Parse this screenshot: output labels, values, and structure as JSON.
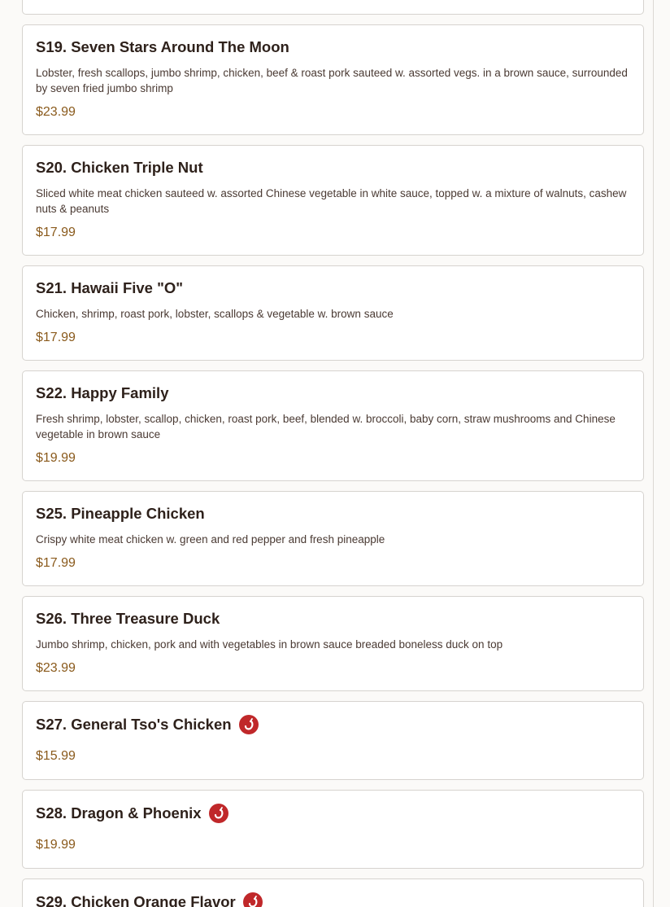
{
  "menu": {
    "items": [
      {
        "name": "S19. Seven Stars Around The Moon",
        "description": "Lobster, fresh scallops, jumbo shrimp, chicken, beef & roast pork sauteed w. assorted vegs. in a brown sauce, surrounded by seven fried jumbo shrimp",
        "price": "$23.99",
        "spicy": false
      },
      {
        "name": "S20. Chicken Triple Nut",
        "description": "Sliced white meat chicken sauteed w. assorted Chinese vegetable in white sauce, topped w. a mixture of walnuts, cashew nuts & peanuts",
        "price": "$17.99",
        "spicy": false
      },
      {
        "name": "S21. Hawaii Five \"O\"",
        "description": "Chicken, shrimp, roast pork, lobster, scallops & vegetable w. brown sauce",
        "price": "$17.99",
        "spicy": false
      },
      {
        "name": "S22. Happy Family",
        "description": "Fresh shrimp, lobster, scallop, chicken, roast pork, beef, blended w. broccoli, baby corn, straw mushrooms and Chinese vegetable in brown sauce",
        "price": "$19.99",
        "spicy": false
      },
      {
        "name": "S25. Pineapple Chicken",
        "description": "Crispy white meat chicken w. green and red pepper and fresh pineapple",
        "price": "$17.99",
        "spicy": false
      },
      {
        "name": "S26. Three Treasure Duck",
        "description": "Jumbo shrimp, chicken, pork and with vegetables in brown sauce breaded boneless duck on top",
        "price": "$23.99",
        "spicy": false
      },
      {
        "name": "S27. General Tso's Chicken",
        "description": "",
        "price": "$15.99",
        "spicy": true
      },
      {
        "name": "S28. Dragon & Phoenix",
        "description": "",
        "price": "$19.99",
        "spicy": true
      },
      {
        "name": "S29. Chicken Orange Flavor",
        "description": "",
        "price": "",
        "spicy": true
      }
    ]
  },
  "colors": {
    "price": "#8a5a1c",
    "spicy_badge": "#c0282a",
    "title": "#2e211b"
  },
  "icons": {
    "spicy": "chili-pepper-icon"
  }
}
